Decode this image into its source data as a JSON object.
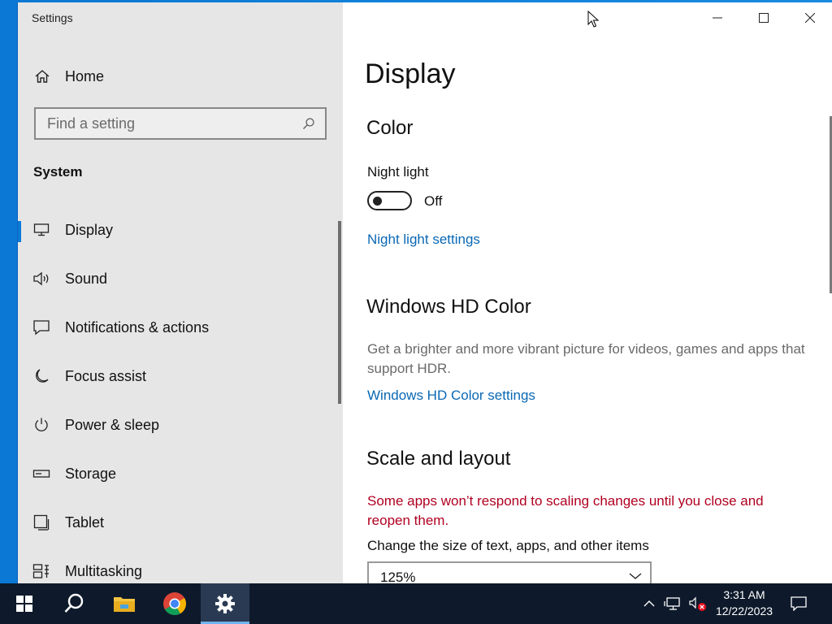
{
  "window": {
    "app_title": "Settings"
  },
  "sidebar": {
    "home_label": "Home",
    "search_placeholder": "Find a setting",
    "section_label": "System",
    "items": [
      {
        "label": "Display",
        "icon": "monitor-icon",
        "active": true
      },
      {
        "label": "Sound",
        "icon": "speaker-icon"
      },
      {
        "label": "Notifications & actions",
        "icon": "notification-icon"
      },
      {
        "label": "Focus assist",
        "icon": "moon-icon"
      },
      {
        "label": "Power & sleep",
        "icon": "power-icon"
      },
      {
        "label": "Storage",
        "icon": "storage-icon"
      },
      {
        "label": "Tablet",
        "icon": "tablet-icon"
      },
      {
        "label": "Multitasking",
        "icon": "multitasking-icon"
      }
    ]
  },
  "main": {
    "page_title": "Display",
    "color": {
      "heading": "Color",
      "night_light_label": "Night light",
      "night_light_state": "Off",
      "night_light_link": "Night light settings"
    },
    "hd_color": {
      "heading": "Windows HD Color",
      "description": "Get a brighter and more vibrant picture for videos, games and apps that support HDR.",
      "link": "Windows HD Color settings"
    },
    "scale": {
      "heading": "Scale and layout",
      "warning": "Some apps won’t respond to scaling changes until you close and reopen them.",
      "size_label": "Change the size of text, apps, and other items",
      "size_value": "125%"
    }
  },
  "taskbar": {
    "time": "3:31 AM",
    "date": "12/22/2023"
  },
  "colors": {
    "accent": "#0a7ad6",
    "link": "#0a68b4",
    "warning": "#b00020",
    "sidebar_bg": "#e6e6e6",
    "taskbar_bg": "#0e1a2b"
  }
}
